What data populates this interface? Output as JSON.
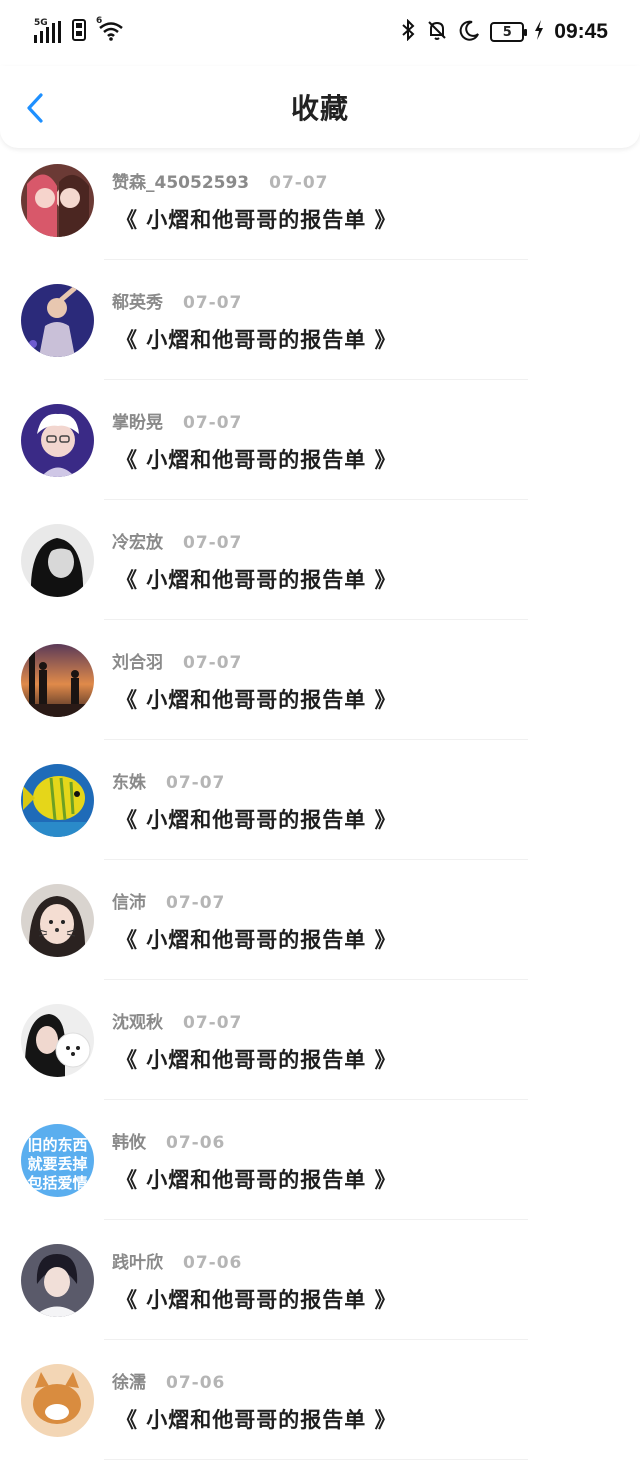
{
  "status_bar": {
    "network": "5G",
    "wifi_label": "6",
    "battery": "5",
    "time": "09:45"
  },
  "header": {
    "title": "收藏",
    "back_icon": "chevron-left-icon"
  },
  "colors": {
    "accent": "#1e90ff",
    "username": "#8a8a8a",
    "date": "#b5b5b5"
  },
  "favorites": [
    {
      "user": "赞森_45052593",
      "date": "07-07",
      "title": "《 小熠和他哥哥的报告单 》"
    },
    {
      "user": "郗英秀",
      "date": "07-07",
      "title": "《 小熠和他哥哥的报告单 》"
    },
    {
      "user": "掌盼晃",
      "date": "07-07",
      "title": "《 小熠和他哥哥的报告单 》"
    },
    {
      "user": "冷宏放",
      "date": "07-07",
      "title": "《 小熠和他哥哥的报告单 》"
    },
    {
      "user": "刘合羽",
      "date": "07-07",
      "title": "《 小熠和他哥哥的报告单 》"
    },
    {
      "user": "东姝",
      "date": "07-07",
      "title": "《 小熠和他哥哥的报告单 》"
    },
    {
      "user": "信沛",
      "date": "07-07",
      "title": "《 小熠和他哥哥的报告单 》"
    },
    {
      "user": "沈观秋",
      "date": "07-07",
      "title": "《 小熠和他哥哥的报告单 》"
    },
    {
      "user": "韩攸",
      "date": "07-06",
      "title": "《 小熠和他哥哥的报告单 》",
      "avatar_text": "旧的东西就要丢掉包括爱情"
    },
    {
      "user": "践叶欣",
      "date": "07-06",
      "title": "《 小熠和他哥哥的报告单 》"
    },
    {
      "user": "徐濡",
      "date": "07-06",
      "title": "《 小熠和他哥哥的报告单 》"
    }
  ]
}
